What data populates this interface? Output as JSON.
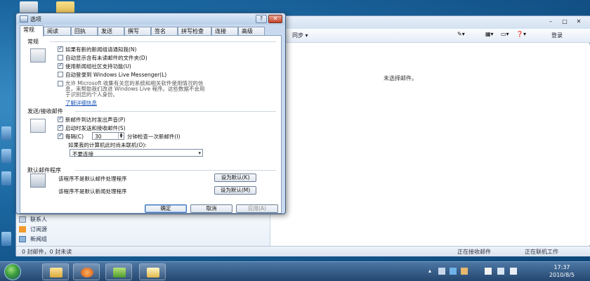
{
  "mail": {
    "toolbar": {
      "sync_label": "同步",
      "signin_label": "登录"
    },
    "reading_pane_text": "未选择邮件。",
    "nav_items": [
      {
        "label": "联系人",
        "icon": "contacts-icon"
      },
      {
        "label": "订阅源",
        "icon": "rss-feed-icon"
      },
      {
        "label": "新闻组",
        "icon": "newsgroup-icon"
      }
    ],
    "status_left": "0 封邮件，0 封未读",
    "status_working": "正在接收邮件",
    "status_offline": "正在联机工作"
  },
  "dialog": {
    "title": "选项",
    "help_label": "?",
    "close_label": "✕",
    "tabs": [
      "常规",
      "阅读",
      "回执",
      "发送",
      "撰写",
      "签名",
      "拼写检查",
      "连接",
      "高级"
    ],
    "active_tab": 0,
    "general_section": {
      "label": "常规",
      "options": [
        {
          "text": "如果有新的新闻组请通知我(N)",
          "checked": true
        },
        {
          "text": "自动显示含有未读邮件的文件夹(D)",
          "checked": false
        },
        {
          "text": "使用新闻组社区支持功能(U)",
          "checked": true
        },
        {
          "text": "自动登录到 Windows Live Messenger(L)",
          "checked": false
        }
      ],
      "privacy_line1": "允许 Microsoft 收集有关您的系统和相关软件使用情况的信",
      "privacy_line2": "息，来帮助我们改进 Windows Live 程序。这些数据不会用",
      "privacy_line3": "于识别您的个人身份。",
      "learn_more": "了解详细信息"
    },
    "send_receive_section": {
      "label": "发送/接收邮件",
      "options": [
        {
          "text": "新邮件到达时发出声音(P)",
          "checked": true
        },
        {
          "text": "启动时发送和接收邮件(S)",
          "checked": true
        }
      ],
      "every_label": "每隔(C)",
      "interval_value": "30",
      "interval_suffix": "分钟检查一次新邮件(I)",
      "interval_checked": true,
      "offline_label": "如果我的计算机此时尚未联机(O):",
      "offline_choice": "不要连接"
    },
    "default_section": {
      "label": "默认邮件程序",
      "mail_text": "该程序不是默认邮件处理程序",
      "mail_button": "设为默认(K)",
      "news_text": "该程序不是默认新闻处理程序",
      "news_button": "设为默认(M)"
    },
    "buttons": {
      "ok": "确定",
      "cancel": "取消",
      "apply": "应用(A)"
    }
  },
  "taskbar": {
    "time": "17:37",
    "date": "2010/8/5"
  }
}
